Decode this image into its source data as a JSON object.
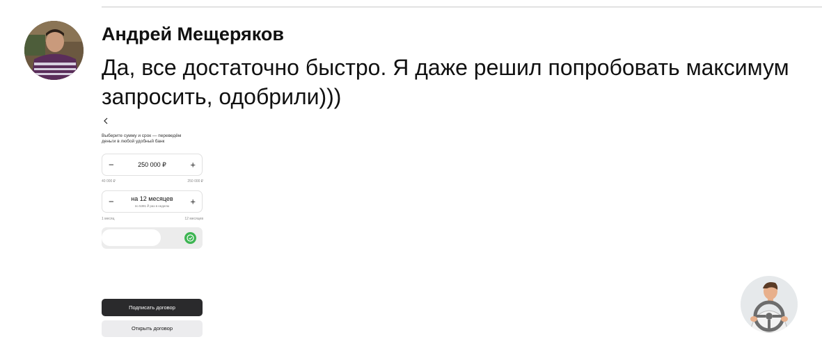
{
  "comment": {
    "author": "Андрей Мещеряков",
    "text": "Да, все достаточно быстро. Я даже решил попробовать максимум запросить, одобрили)))"
  },
  "screenshot": {
    "back_icon": "chevron-left-icon",
    "intro": "Выберите сумму и срок — переведём деньги в любой удобный банк",
    "amount": {
      "value": "250 000 ₽",
      "min_label": "40 000 ₽",
      "max_label": "250 000 ₽",
      "fraction": 1.0
    },
    "term": {
      "value": "на 12 месяцев",
      "sub": "по 5391 ₽ раз в неделю",
      "min_label": "1 месяц",
      "max_label": "12 месяцев"
    },
    "toggle_icon": "check-circle-icon",
    "sign_button": "Подписать договор",
    "open_button": "Открыть договор"
  },
  "colors": {
    "accent_green": "#3db552",
    "dark_button": "#2a2a2c"
  }
}
